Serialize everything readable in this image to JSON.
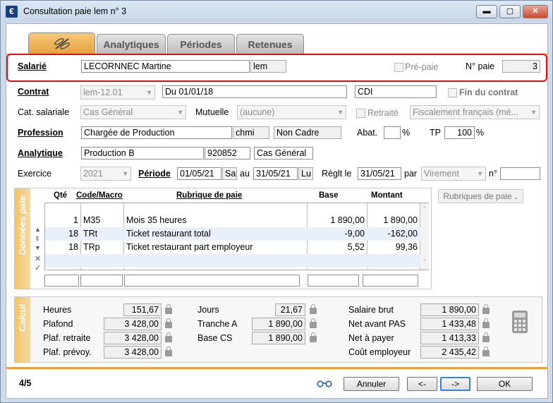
{
  "window": {
    "title": "Consultation paie lem n° 3",
    "app_icon": "€",
    "minimize": "▬",
    "maximize": "▢",
    "close": "✕"
  },
  "tabs": [
    {
      "label": "",
      "icon": "dragonfly-icon"
    },
    {
      "label": "Analytiques"
    },
    {
      "label": "Périodes"
    },
    {
      "label": "Retenues"
    }
  ],
  "header": {
    "salarie_label": "Salarié",
    "salarie_name": "LECORNNEC Martine",
    "salarie_code": "lem",
    "prepaie_label": "Pré-paie",
    "npaie_label": "N° paie",
    "npaie_value": "3"
  },
  "contrat": {
    "label": "Contrat",
    "code": "lem-12.01",
    "date": "Du 01/01/18",
    "type": "CDI",
    "fin_label": "Fin du contrat"
  },
  "categorie": {
    "label": "Cat. salariale",
    "value": "Cas Général",
    "mutuelle_label": "Mutuelle",
    "mutuelle_value": "(aucune)",
    "retraite_label": "Retraité",
    "fiscal_value": "Fiscalement français (mé..."
  },
  "profession": {
    "label": "Profession",
    "value": "Chargée de Production",
    "code": "chmi",
    "statut": "Non Cadre",
    "abat_label": "Abat.",
    "abat_value": "",
    "pct": "%",
    "tp_label": "TP",
    "tp_value": "100",
    "tp_pct": "%"
  },
  "analytique": {
    "label": "Analytique",
    "value": "Production B",
    "code": "920852",
    "cas": "Cas Général"
  },
  "exercice": {
    "label": "Exercice",
    "value": "2021",
    "periode_label": "Période",
    "date_from": "01/05/21",
    "day_from": "Sa",
    "au": "au",
    "date_to": "31/05/21",
    "day_to": "Lu",
    "reglt_label": "Règlt le",
    "reglt_date": "31/05/21",
    "par": "par",
    "mode": "Virement",
    "n_label": "n°",
    "n_value": ""
  },
  "donnees": {
    "side_label": "Données paie",
    "rubriques_button": "Rubriques de paie",
    "headers": {
      "qte": "Qté",
      "code": "Code/Macro",
      "rubrique": "Rubrique de paie",
      "base": "Base",
      "montant": "Montant"
    },
    "rows": [
      {
        "qte": "1",
        "code": "M35",
        "rubrique": "Mois 35 heures",
        "base": "1 890,00",
        "montant": "1 890,00"
      },
      {
        "qte": "18",
        "code": "TRt",
        "rubrique": "Ticket restaurant total",
        "base": "-9,00",
        "montant": "-162,00"
      },
      {
        "qte": "18",
        "code": "TRp",
        "rubrique": "Ticket restaurant part employeur",
        "base": "5,52",
        "montant": "99,36"
      }
    ]
  },
  "calcul": {
    "side_label": "Calcul",
    "heures_label": "Heures",
    "heures": "151,67",
    "plafond_label": "Plafond",
    "plafond": "3 428,00",
    "plaf_retraite_label": "Plaf. retraite",
    "plaf_retraite": "3 428,00",
    "plaf_prevoy_label": "Plaf. prévoy.",
    "plaf_prevoy": "3 428,00",
    "jours_label": "Jours",
    "jours": "21,67",
    "tranche_label": "Tranche A",
    "tranche": "1 890,00",
    "basecs_label": "Base CS",
    "basecs": "1 890,00",
    "brut_label": "Salaire brut",
    "brut": "1 890,00",
    "netpas_label": "Net avant PAS",
    "netpas": "1 433,48",
    "netpayer_label": "Net à payer",
    "netpayer": "1 413,33",
    "cout_label": "Coût employeur",
    "cout": "2 435,42"
  },
  "footer": {
    "counter": "4/5",
    "annuler": "Annuler",
    "prev": "<-",
    "next": "->",
    "ok": "OK"
  }
}
